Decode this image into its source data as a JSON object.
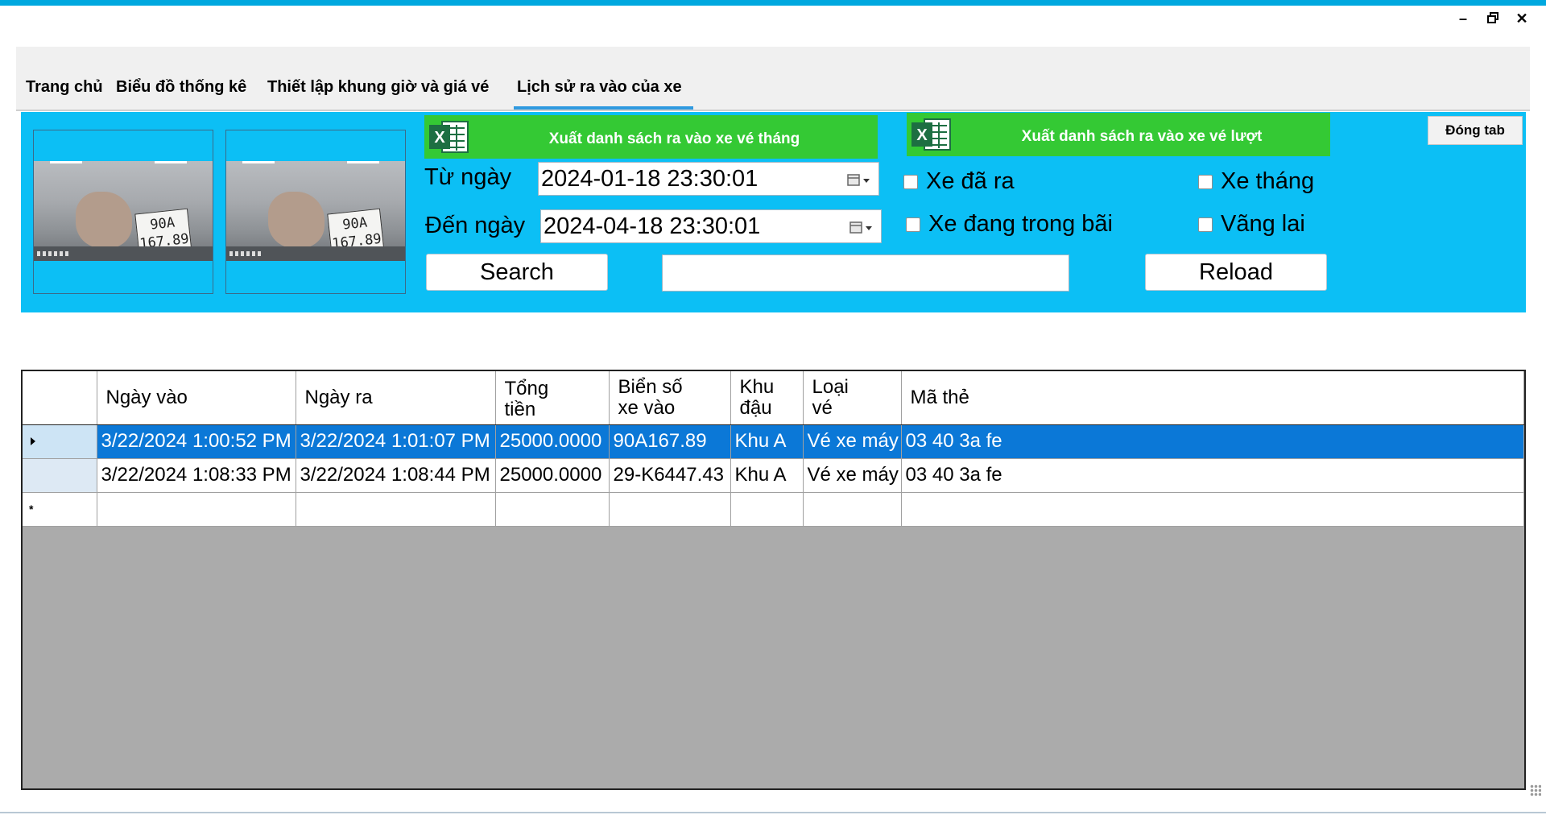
{
  "window": {
    "minimize_symbol": "–",
    "close_symbol": "✕"
  },
  "tabs": [
    {
      "label": "Trang chủ"
    },
    {
      "label": "Biểu đồ thống kê"
    },
    {
      "label": "Thiết lập khung giờ và giá vé"
    },
    {
      "label": "Lịch sử ra vào của xe"
    }
  ],
  "active_tab": "Lịch sử ra vào của xe",
  "cameras": [
    {
      "plate_line1": "90A",
      "plate_line2": "167.89"
    },
    {
      "plate_line1": "90A",
      "plate_line2": "167.89"
    }
  ],
  "toolbar": {
    "export_monthly_label": "Xuất danh sách ra vào xe vé tháng",
    "export_ticket_label": "Xuất danh sách ra vào xe vé lượt",
    "close_tab_label": "Đóng tab",
    "from_label": "Từ ngày",
    "to_label": "Đến ngày",
    "from_value": "2024-01-18 23:30:01",
    "to_value": "2024-04-18 23:30:01",
    "search_label": "Search",
    "reload_label": "Reload",
    "search_text": ""
  },
  "filters": {
    "exited": {
      "label": "Xe đã ra",
      "checked": false
    },
    "in_lot": {
      "label": "Xe đang trong bãi",
      "checked": false
    },
    "monthly": {
      "label": "Xe tháng",
      "checked": false
    },
    "walk_in": {
      "label": "Vãng lai",
      "checked": false
    }
  },
  "grid": {
    "columns": [
      {
        "line1": "Ngày vào",
        "line2": ""
      },
      {
        "line1": "Ngày ra",
        "line2": ""
      },
      {
        "line1": "Tổng",
        "line2": "tiền"
      },
      {
        "line1": "Biển số",
        "line2": "xe vào"
      },
      {
        "line1": "Khu",
        "line2": "đậu"
      },
      {
        "line1": "Loại",
        "line2": "vé"
      },
      {
        "line1": "Mã thẻ",
        "line2": ""
      }
    ],
    "rows": [
      [
        "3/22/2024 1:00:52 PM",
        "3/22/2024 1:01:07 PM",
        "25000.0000",
        "90A167.89",
        "Khu A",
        "Vé xe máy",
        "03 40 3a fe"
      ],
      [
        "3/22/2024 1:08:33 PM",
        "3/22/2024 1:08:44 PM",
        "25000.0000",
        "29-K6447.43",
        "Khu A",
        "Vé xe máy",
        "03 40 3a fe"
      ]
    ],
    "selected_row_index": 0,
    "new_row_marker": "*",
    "colors": {
      "selected": "#0b78d7",
      "panel": "#0cbff5",
      "excel": "#34c934"
    }
  }
}
